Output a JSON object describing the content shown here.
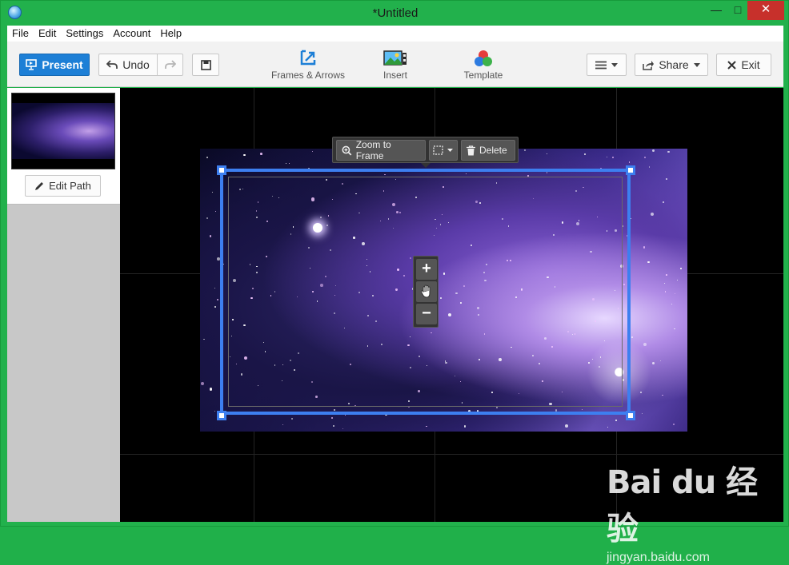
{
  "window": {
    "title": "*Untitled",
    "min_glyph": "—",
    "max_glyph": "□",
    "close_glyph": "✕"
  },
  "menu": [
    "File",
    "Edit",
    "Settings",
    "Account",
    "Help"
  ],
  "toolbar": {
    "present_label": "Present",
    "undo_label": "Undo",
    "frames_label": "Frames & Arrows",
    "insert_label": "Insert",
    "template_label": "Template",
    "share_label": "Share",
    "exit_label": "Exit"
  },
  "sidebar": {
    "edit_path_label": "Edit Path"
  },
  "frame_toolbar": {
    "zoom_label": "Zoom to Frame",
    "delete_label": "Delete"
  },
  "zoom_controls": {
    "plus": "+",
    "minus": "−"
  },
  "watermark": {
    "logo_text": "Bai du 经验",
    "url": "jingyan.baidu.com"
  },
  "colors": {
    "window_green": "#22b14c",
    "accent_blue": "#1d7fd6",
    "selection_blue": "#3d7ff0",
    "close_red": "#c7302b"
  }
}
